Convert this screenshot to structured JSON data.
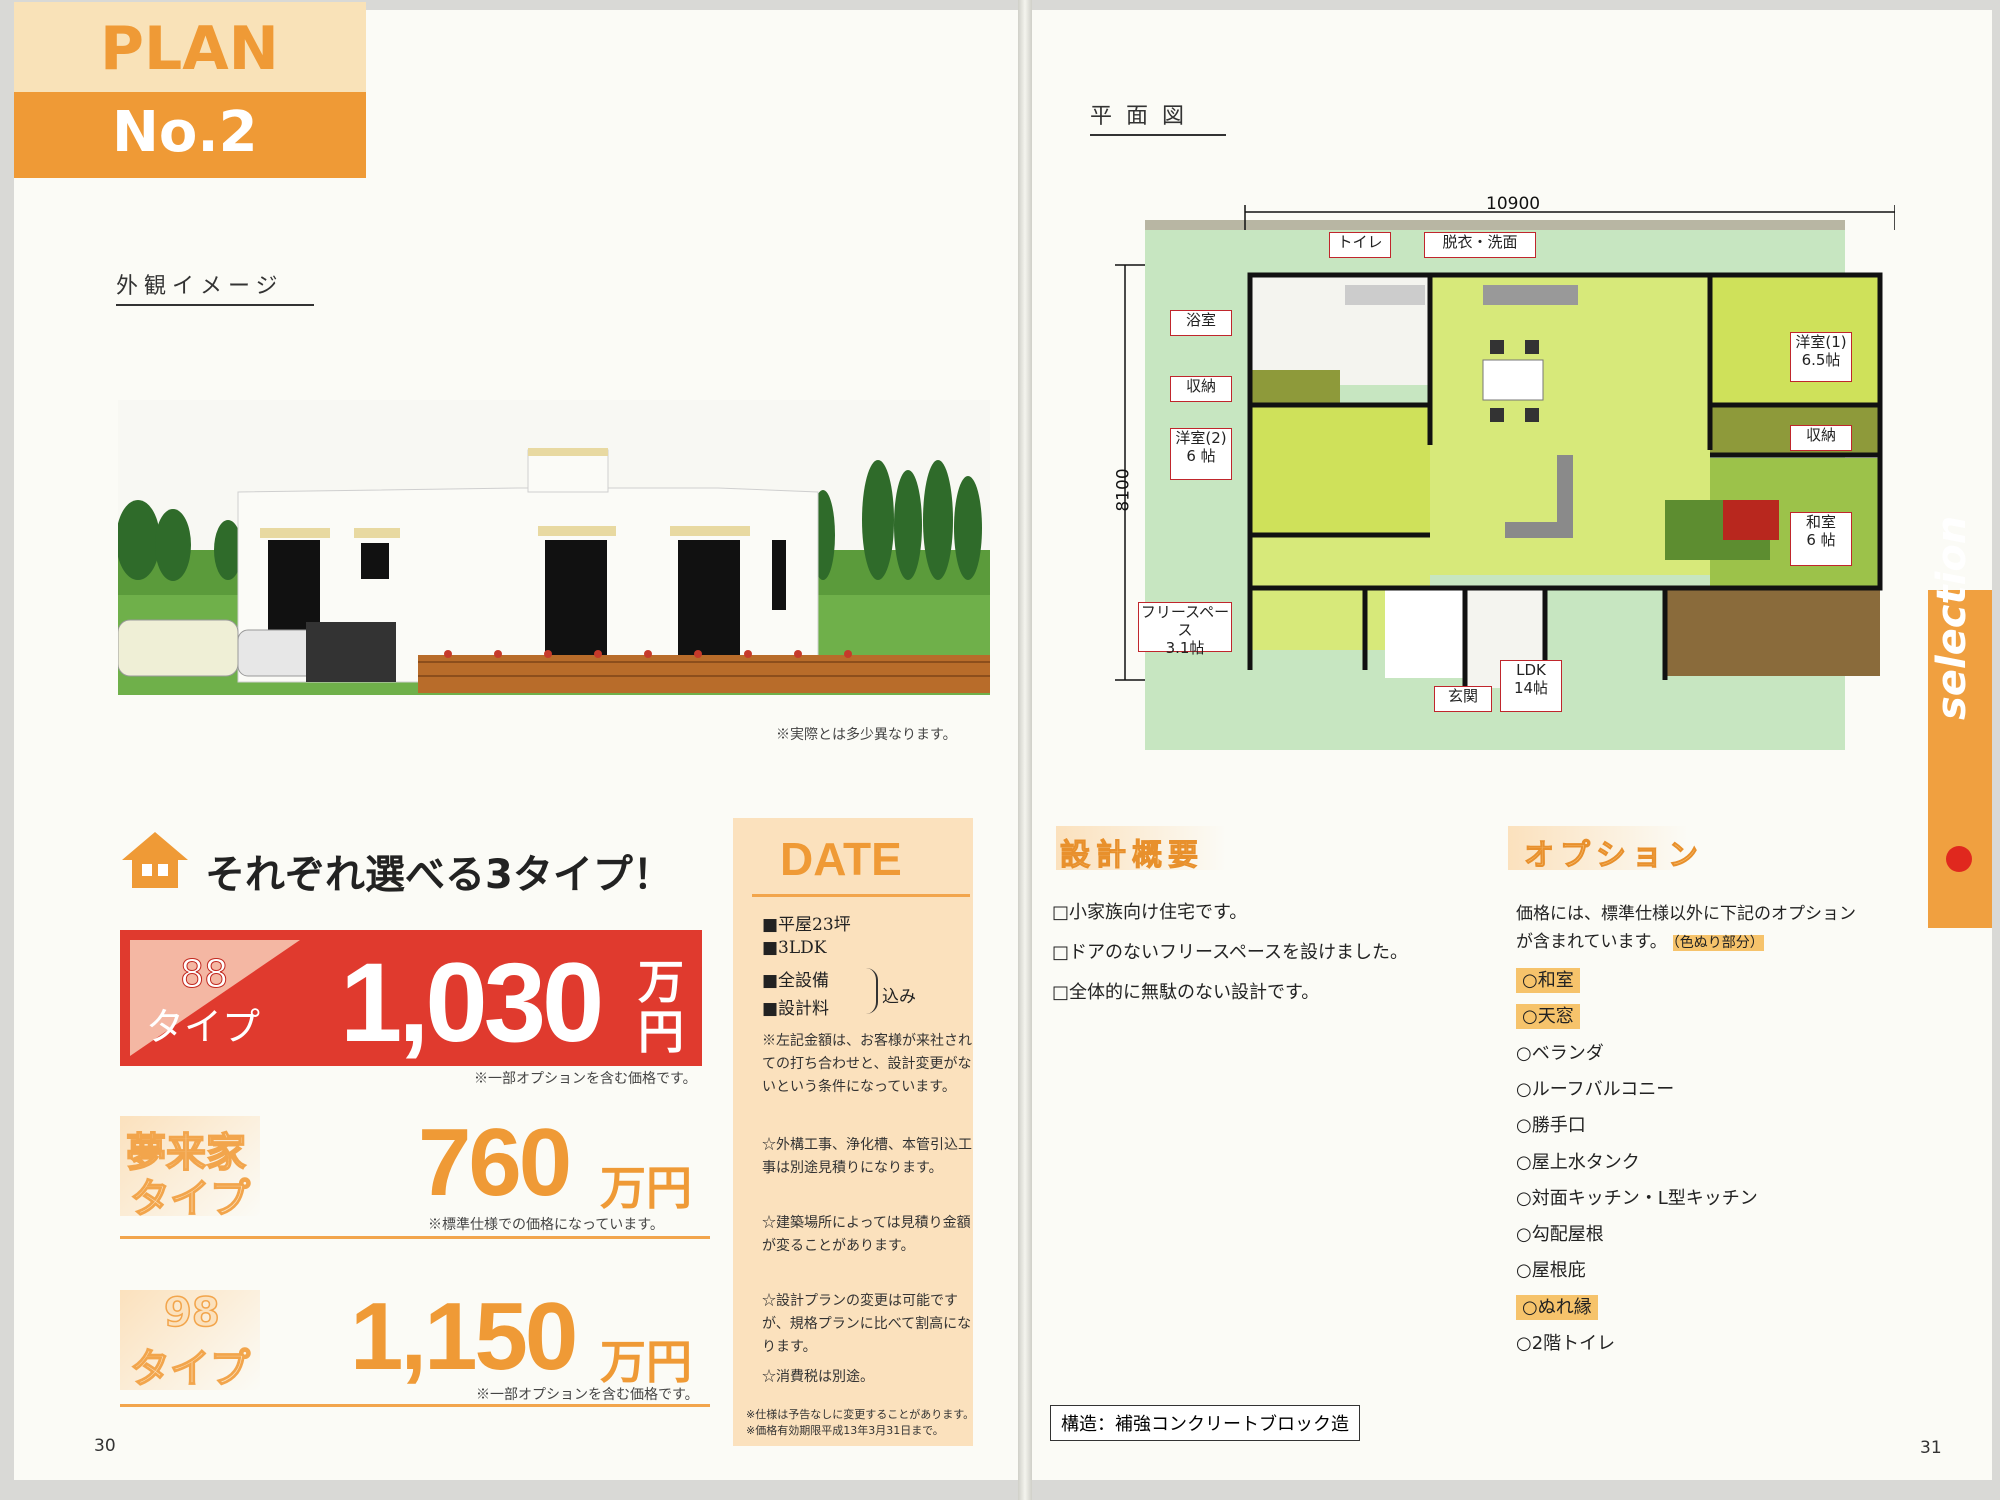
{
  "left_page": {
    "plan_label": "PLAN",
    "plan_no": "No.2",
    "exterior_heading": "外観イメージ",
    "exterior_note": "※実際とは多少異なります。",
    "headline": "それぞれ選べる3タイプ！",
    "types": [
      {
        "name_line1": "88",
        "name_line2": "タイプ",
        "price": "1,030",
        "unit_top": "万",
        "unit_bottom": "円",
        "note": "※一部オプションを含む価格です。"
      },
      {
        "name_line1": "夢来家",
        "name_line2": "タイプ",
        "price": "760",
        "unit": "万円",
        "note": "※標準仕様での価格になっています。"
      },
      {
        "name_line1": "98",
        "name_line2": "タイプ",
        "price": "1,150",
        "unit": "万円",
        "note": "※一部オプションを含む価格です。"
      }
    ],
    "page_number": "30",
    "date_box": {
      "title": "DATE",
      "specs": [
        "■平屋23坪",
        "■3LDK",
        "■全設備",
        "■設計料"
      ],
      "bracket_label": "込み",
      "notes": [
        "※左記金額は、お客様が来社されての打ち合わせと、設計変更がないという条件になっています。",
        "☆外構工事、浄化槽、本管引込工事は別途見積りになります。",
        "☆建築場所によっては見積り金額が変ることがあります。",
        "☆設計プランの変更は可能ですが、規格プランに比べて割高になります。",
        "☆消費税は別途。"
      ],
      "footer_notes": [
        "※仕様は予告なしに変更することがあります。",
        "※価格有効期限平成13年3月31日まで。"
      ]
    }
  },
  "right_page": {
    "floorplan_heading": "平面図",
    "dimension_width": "10900",
    "dimension_height": "8100",
    "rooms": {
      "toilet": "トイレ",
      "wash": "脱衣・洗面",
      "bath": "浴室",
      "storage1": "収納",
      "western2": "洋室(2)",
      "western2_size": "6 帖",
      "western1": "洋室(1)",
      "western1_size": "6.5帖",
      "storage2": "収納",
      "japanese": "和室",
      "japanese_size": "6 帖",
      "free_space": "フリースペース",
      "free_space_size": "3.1帖",
      "entrance": "玄関",
      "ldk": "LDK",
      "ldk_size": "14帖"
    },
    "design_heading": "設計概要",
    "design_points": [
      "□小家族向け住宅です。",
      "□ドアのないフリースペースを設けました。",
      "□全体的に無駄のない設計です。"
    ],
    "option_heading": "オプション",
    "option_intro": "価格には、標準仕様以外に下記のオプションが含まれています。",
    "option_intro_tag": "（色ぬり部分）",
    "options": [
      {
        "label": "○和室",
        "included": true
      },
      {
        "label": "○天窓",
        "included": true
      },
      {
        "label": "○ベランダ",
        "included": false
      },
      {
        "label": "○ルーフバルコニー",
        "included": false
      },
      {
        "label": "○勝手口",
        "included": false
      },
      {
        "label": "○屋上水タンク",
        "included": false
      },
      {
        "label": "○対面キッチン・L型キッチン",
        "included": false
      },
      {
        "label": "○勾配屋根",
        "included": false
      },
      {
        "label": "○屋根庇",
        "included": false
      },
      {
        "label": "○ぬれ縁",
        "included": true
      },
      {
        "label": "○2階トイレ",
        "included": false
      }
    ],
    "structure": "構造：補強コンクリートブロック造",
    "side_tab": "selection",
    "page_number": "31"
  },
  "colors": {
    "orange": "#ef9a36",
    "red_badge": "#e03a2e",
    "highlight": "#f6c36b"
  }
}
